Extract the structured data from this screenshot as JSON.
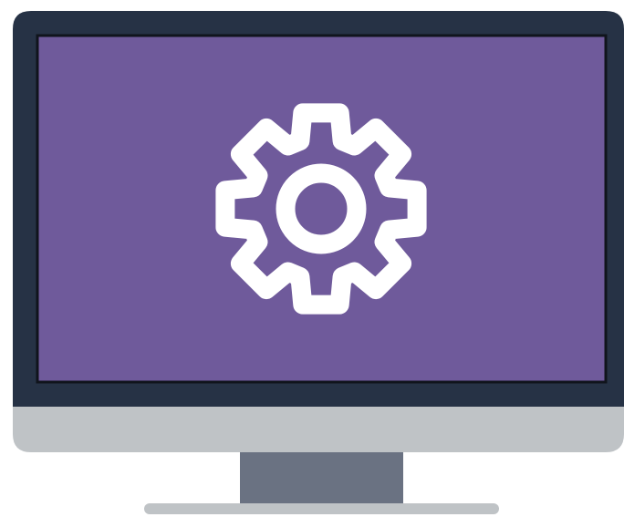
{
  "illustration": {
    "subject": "desktop-monitor-with-settings-gear",
    "icon": "gear-icon",
    "colors": {
      "bezel": "#263245",
      "screen": "#6f5a9b",
      "screen_border": "#10141c",
      "gear": "#ffffff",
      "chin": "#bfc3c6",
      "stand_neck": "#6a7282",
      "stand_base": "#bfc3c6",
      "background": "#ffffff"
    }
  }
}
